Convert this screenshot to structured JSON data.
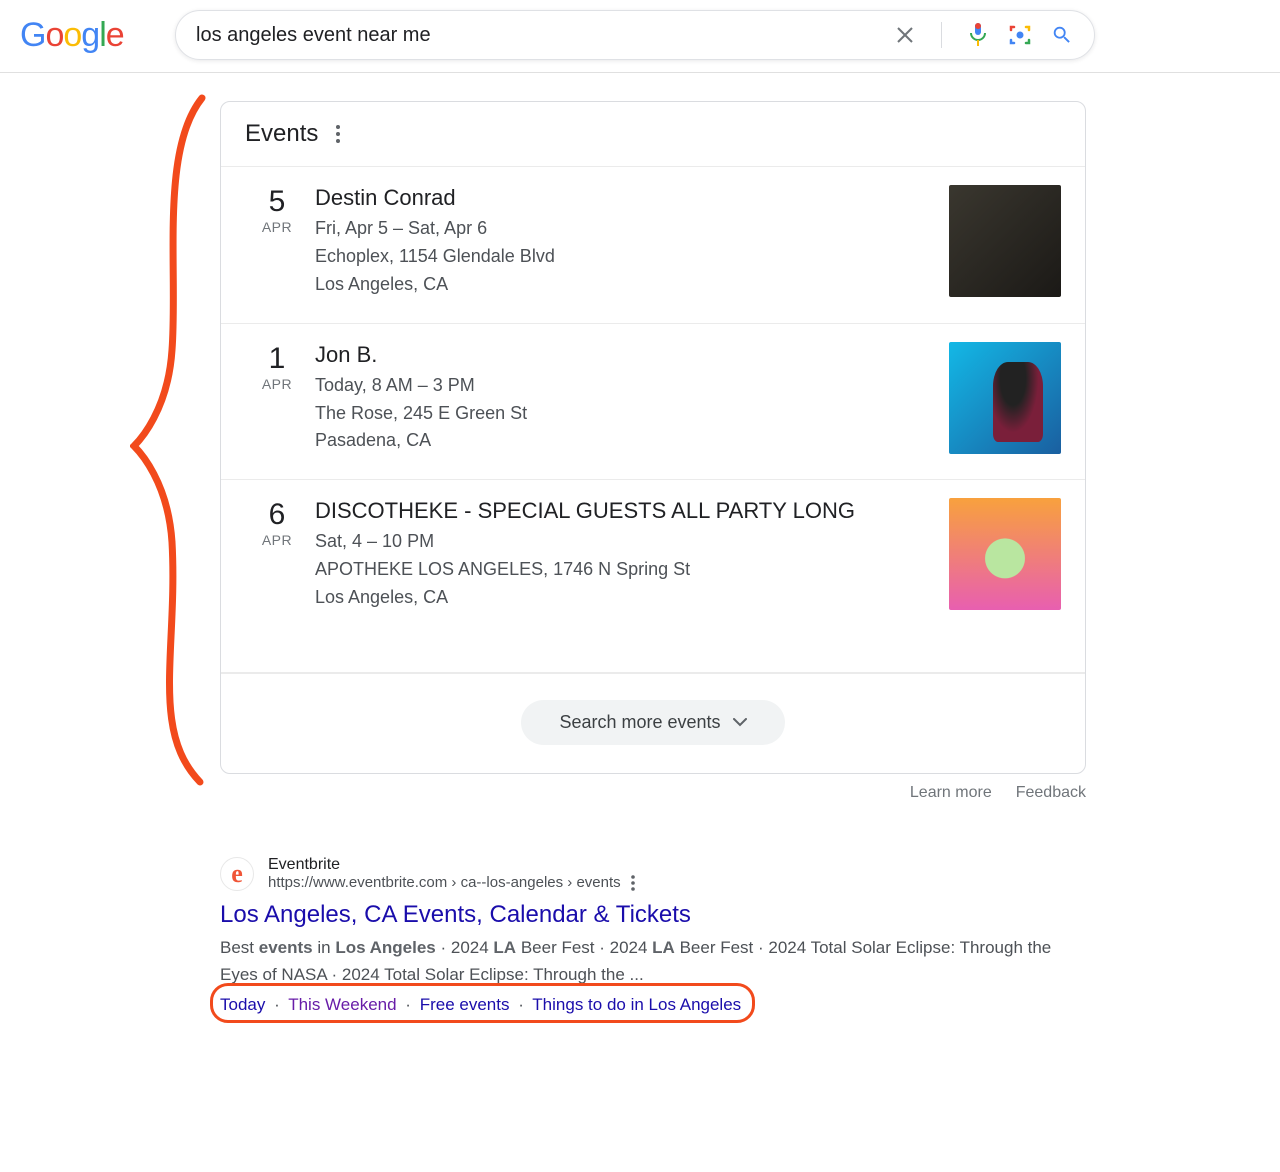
{
  "search": {
    "query": "los angeles event near me"
  },
  "events_panel": {
    "title": "Events",
    "items": [
      {
        "day": "5",
        "month": "APR",
        "title": "Destin Conrad",
        "when": "Fri, Apr 5 – Sat, Apr 6",
        "venue": "Echoplex, 1154 Glendale Blvd",
        "city": "Los Angeles, CA"
      },
      {
        "day": "1",
        "month": "APR",
        "title": "Jon B.",
        "when": "Today, 8 AM – 3 PM",
        "venue": "The Rose, 245 E Green St",
        "city": "Pasadena, CA"
      },
      {
        "day": "6",
        "month": "APR",
        "title": "DISCOTHEKE - SPECIAL GUESTS ALL PARTY LONG",
        "when": "Sat, 4 – 10 PM",
        "venue": "APOTHEKE LOS ANGELES, 1746 N Spring St",
        "city": "Los Angeles, CA"
      }
    ],
    "more_label": "Search more events",
    "footer": {
      "learn": "Learn more",
      "feedback": "Feedback"
    }
  },
  "result": {
    "site": "Eventbrite",
    "url_display": "https://www.eventbrite.com › ca--los-angeles › events",
    "title": "Los Angeles, CA Events, Calendar & Tickets",
    "desc_plain": "Best events in Los Angeles · 2024 LA Beer Fest · 2024 LA Beer Fest · 2024 Total Solar Eclipse: Through the Eyes of NASA · 2024 Total Solar Eclipse: Through the ...",
    "sitelinks": {
      "today": "Today",
      "weekend": "This Weekend",
      "free": "Free events",
      "things": "Things to do in Los Angeles"
    }
  }
}
